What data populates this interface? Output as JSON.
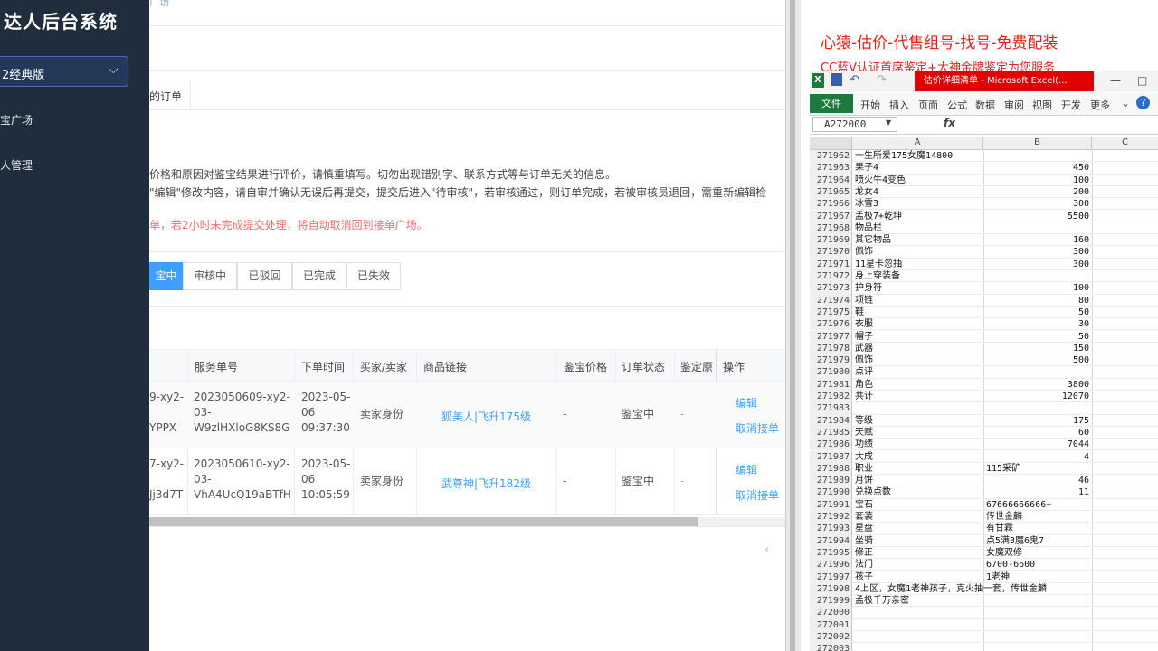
{
  "sidebar": {
    "title": "达人后台系统",
    "version_select": "2经典版",
    "items": [
      {
        "label": "宝广场"
      },
      {
        "label": "人管理"
      }
    ]
  },
  "main": {
    "breadcrumb": "广场",
    "tab_label": "的订单",
    "notes": [
      "价格和原因对鉴宝结果进行评价，请慎重填写。切勿出现错别字、联系方式等与订单无关的信息。",
      "\"编辑\"修改内容，请自审并确认无误后再提交，提交后进入\"待审核\"，若审核通过，则订单完成，若被审核员退回，需重新编辑检",
      "单，若2小时未完成提交处理，将自动取消回到接单广场。"
    ],
    "filter_tabs": [
      "宝中",
      "审核中",
      "已驳回",
      "已完成",
      "已失效"
    ],
    "table": {
      "headers": [
        "服务单号",
        "下单时间",
        "买家/卖家",
        "商品链接",
        "鉴宝价格",
        "订单状态",
        "鉴定原",
        "操作"
      ],
      "rows": [
        {
          "prev_id": [
            "9-xy2-",
            "",
            "YPPX"
          ],
          "service_no": [
            "2023050609-xy2-",
            "03-",
            "W9zlHXloG8KS8G"
          ],
          "time": [
            "2023-05-",
            "06",
            "09:37:30"
          ],
          "role": "卖家身份",
          "link": "狐美人|飞升175级",
          "price": "-",
          "status": "鉴宝中",
          "reason": "-",
          "actions": [
            "编辑",
            "取消接单"
          ]
        },
        {
          "prev_id": [
            "7-xy2-",
            "",
            "Jj3d7T"
          ],
          "service_no": [
            "2023050610-xy2-",
            "03-",
            "VhA4UcQ19aBTfH"
          ],
          "time": [
            "2023-05-",
            "06",
            "10:05:59"
          ],
          "role": "卖家身份",
          "link": "武尊神|飞升182级",
          "price": "-",
          "status": "鉴宝中",
          "reason": "-",
          "actions": [
            "编辑",
            "取消接单"
          ]
        }
      ]
    },
    "pager_prev": "‹"
  },
  "right": {
    "promo_line1": "心猿-估价-代售组号-找号-免费配装",
    "promo_line2": "CC蓝V认证首席鉴定+大神金牌鉴定为您服务",
    "excel_title": "估价详细清单 - Microsoft Excel(...",
    "ribbon_file": "文件",
    "ribbon_tabs": [
      "开始",
      "插入",
      "页面",
      "公式",
      "数据",
      "审阅",
      "视图",
      "开发",
      "更多"
    ],
    "name_box": "A272000",
    "fx": "fx",
    "col_headers": [
      "A",
      "B",
      "C"
    ],
    "rows": [
      {
        "n": "271962",
        "a": "一生所爱175女魔14800",
        "b": ""
      },
      {
        "n": "271963",
        "a": "果子4",
        "b": "450"
      },
      {
        "n": "271964",
        "a": "喷火牛4变色",
        "b": "100"
      },
      {
        "n": "271965",
        "a": "龙女4",
        "b": "200"
      },
      {
        "n": "271966",
        "a": "冰雪3",
        "b": "300"
      },
      {
        "n": "271967",
        "a": "孟极7+乾坤",
        "b": "5500"
      },
      {
        "n": "271968",
        "a": "物品栏",
        "b": ""
      },
      {
        "n": "271969",
        "a": "其它物品",
        "b": "160"
      },
      {
        "n": "271970",
        "a": "佩饰",
        "b": "300"
      },
      {
        "n": "271971",
        "a": "11星卡忽抽",
        "b": "300"
      },
      {
        "n": "271972",
        "a": "身上穿装备",
        "b": ""
      },
      {
        "n": "271973",
        "a": "护身符",
        "b": "100"
      },
      {
        "n": "271974",
        "a": "项链",
        "b": "80"
      },
      {
        "n": "271975",
        "a": "鞋",
        "b": "50"
      },
      {
        "n": "271976",
        "a": "衣服",
        "b": "30"
      },
      {
        "n": "271977",
        "a": "帽子",
        "b": "50"
      },
      {
        "n": "271978",
        "a": "武器",
        "b": "150"
      },
      {
        "n": "271979",
        "a": "佩饰",
        "b": "500"
      },
      {
        "n": "271980",
        "a": "点评",
        "b": ""
      },
      {
        "n": "271981",
        "a": "角色",
        "b": "3800"
      },
      {
        "n": "271982",
        "a": "共计",
        "b": "12070"
      },
      {
        "n": "271983",
        "a": "",
        "b": ""
      },
      {
        "n": "271984",
        "a": "等级",
        "b": "175"
      },
      {
        "n": "271985",
        "a": "天赋",
        "b": "60"
      },
      {
        "n": "271986",
        "a": "功绩",
        "b": "7044"
      },
      {
        "n": "271987",
        "a": "大成",
        "b": "4"
      },
      {
        "n": "271988",
        "a": "职业",
        "b": "115采矿"
      },
      {
        "n": "271989",
        "a": "月饼",
        "b": "46"
      },
      {
        "n": "271990",
        "a": "兑换点数",
        "b": "11"
      },
      {
        "n": "271991",
        "a": "宝石",
        "b": "67666666666+"
      },
      {
        "n": "271992",
        "a": "套装",
        "b": "传世金麟"
      },
      {
        "n": "271993",
        "a": "星盘",
        "b": "有甘霖"
      },
      {
        "n": "271994",
        "a": "坐骑",
        "b": "点5满3魔6鬼7"
      },
      {
        "n": "271995",
        "a": "修正",
        "b": "女魔双修"
      },
      {
        "n": "271996",
        "a": "法门",
        "b": "6700-6600"
      },
      {
        "n": "271997",
        "a": "孩子",
        "b": "1老神"
      },
      {
        "n": "271998",
        "a": "4上区，女魔1老神孩子，克火抽一套，传世金麟",
        "b": ""
      },
      {
        "n": "271999",
        "a": "孟极千万亲密",
        "b": ""
      },
      {
        "n": "272000",
        "a": "",
        "b": ""
      },
      {
        "n": "272001",
        "a": "",
        "b": ""
      },
      {
        "n": "272002",
        "a": "",
        "b": ""
      },
      {
        "n": "272003",
        "a": "",
        "b": ""
      }
    ]
  }
}
